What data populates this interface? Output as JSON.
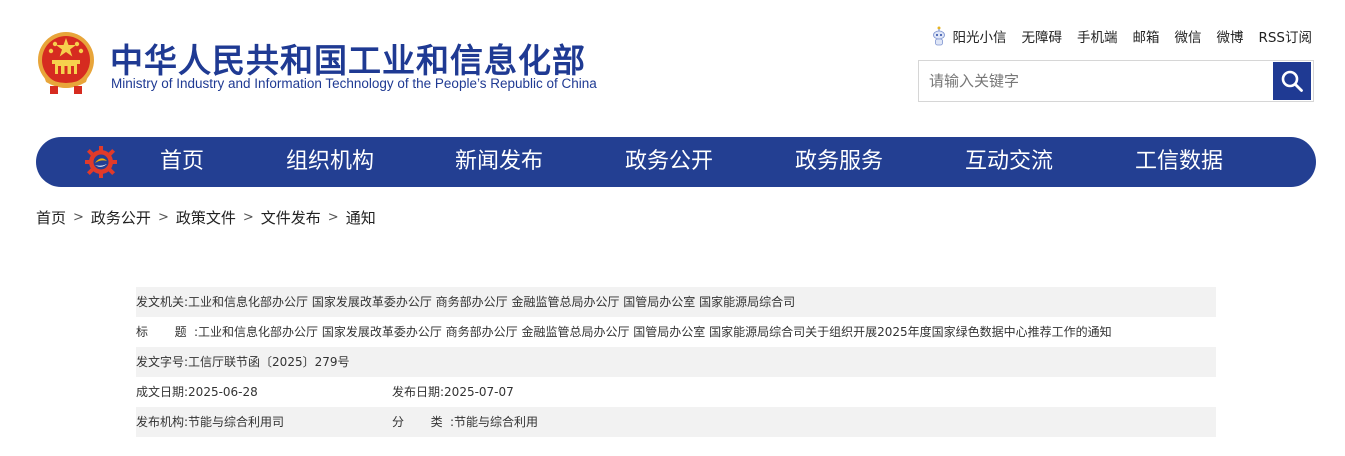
{
  "header": {
    "title_cn": "中华人民共和国工业和信息化部",
    "title_en": "Ministry of Industry and Information Technology of the People’s Republic of China"
  },
  "top_links": [
    "阳光小信",
    "无障碍",
    "手机端",
    "邮箱",
    "微信",
    "微博",
    "RSS订阅"
  ],
  "search": {
    "placeholder": "请输入关键字",
    "value": ""
  },
  "nav": {
    "items": [
      "首页",
      "组织机构",
      "新闻发布",
      "政务公开",
      "政务服务",
      "互动交流",
      "工信数据"
    ]
  },
  "breadcrumb": [
    "首页",
    "政务公开",
    "政策文件",
    "文件发布",
    "通知"
  ],
  "breadcrumb_separator": ">",
  "doc_info": {
    "issuer_label": "发文机关:",
    "issuer_value": "工业和信息化部办公厅 国家发展改革委办公厅 商务部办公厅 金融监管总局办公厅 国管局办公室 国家能源局综合司",
    "title_label": "标　题:",
    "title_value": "工业和信息化部办公厅 国家发展改革委办公厅 商务部办公厅 金融监管总局办公厅 国管局办公室 国家能源局综合司关于组织开展2025年度国家绿色数据中心推荐工作的通知",
    "doc_no_label": "发文字号:",
    "doc_no_value": "工信厅联节函〔2025〕279号",
    "created_label": "成文日期:",
    "created_value": "2025-06-28",
    "published_label": "发布日期:",
    "published_value": "2025-07-07",
    "org_label": "发布机构:",
    "org_value": "节能与综合利用司",
    "category_label": "分　类:",
    "category_value": "节能与综合利用"
  },
  "colors": {
    "brand_blue": "#1f3a93",
    "nav_blue": "#233f92",
    "row_shade": "#f2f2f2"
  },
  "icons": {
    "emblem": "national-emblem-icon",
    "robot": "robot-assistant-icon",
    "search": "search-icon",
    "nav_logo": "gear-logo-icon"
  }
}
